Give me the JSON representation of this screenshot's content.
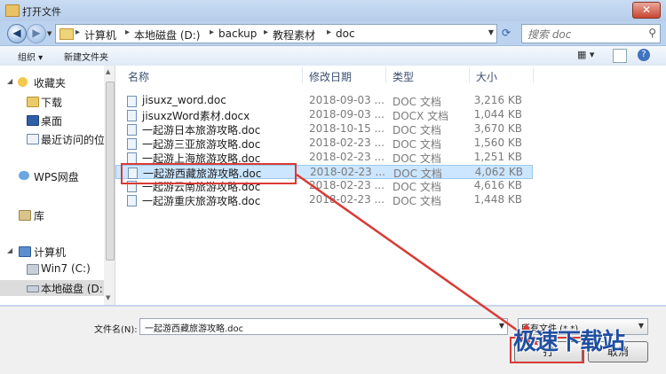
{
  "window": {
    "title": "打开文件",
    "close_label": "✕"
  },
  "address_bar": {
    "crumbs": [
      "计算机",
      "本地磁盘 (D:)",
      "backup",
      "教程素材",
      "doc"
    ],
    "separator": "▸",
    "search_placeholder": "搜索 doc"
  },
  "toolbar": {
    "organize": "组织 ▾",
    "new_folder": "新建文件夹"
  },
  "sidebar": {
    "items": [
      {
        "label": "收藏夹",
        "icon": "star-icon"
      },
      {
        "label": "下载",
        "icon": "download-folder-icon"
      },
      {
        "label": "桌面",
        "icon": "desktop-icon"
      },
      {
        "label": "最近访问的位",
        "icon": "recent-places-icon"
      },
      {
        "label": "WPS网盘",
        "icon": "cloud-icon"
      },
      {
        "label": "库",
        "icon": "library-icon"
      },
      {
        "label": "计算机",
        "icon": "computer-icon"
      },
      {
        "label": "Win7 (C:)",
        "icon": "system-drive-icon"
      },
      {
        "label": "本地磁盘 (D:",
        "icon": "drive-icon"
      }
    ]
  },
  "file_list": {
    "columns": [
      "名称",
      "修改日期",
      "类型",
      "大小"
    ],
    "rows": [
      {
        "name": "jisuxz_word.doc",
        "date": "2018-09-03 ...",
        "type": "DOC 文档",
        "size": "3,216 KB"
      },
      {
        "name": "jisuxzWord素材.docx",
        "date": "2018-09-03 ...",
        "type": "DOCX 文档",
        "size": "1,044 KB"
      },
      {
        "name": "一起游日本旅游攻略.doc",
        "date": "2018-10-15 ...",
        "type": "DOC 文档",
        "size": "3,670 KB"
      },
      {
        "name": "一起游三亚旅游攻略.doc",
        "date": "2018-02-23 ...",
        "type": "DOC 文档",
        "size": "1,560 KB"
      },
      {
        "name": "一起游上海旅游攻略.doc",
        "date": "2018-02-23 ...",
        "type": "DOC 文档",
        "size": "1,251 KB"
      },
      {
        "name": "一起游西藏旅游攻略.doc",
        "date": "2018-02-23 ...",
        "type": "DOC 文档",
        "size": "4,062 KB"
      },
      {
        "name": "一起游云南旅游攻略.doc",
        "date": "2018-02-23 ...",
        "type": "DOC 文档",
        "size": "4,616 KB"
      },
      {
        "name": "一起游重庆旅游攻略.doc",
        "date": "2018-02-23 ...",
        "type": "DOC 文档",
        "size": "1,448 KB"
      }
    ],
    "selected_index": 5
  },
  "bottom": {
    "filename_label": "文件名(N):",
    "filename_value": "一起游西藏旅游攻略.doc",
    "filetype_value": "所有文件 (*.*)",
    "open_button": "打",
    "cancel_button": "取消"
  },
  "watermark": "极速下载站",
  "colors": {
    "annotation": "#d93a36",
    "selection": "#cce6ff",
    "title_bg": "#bcd3ef"
  }
}
